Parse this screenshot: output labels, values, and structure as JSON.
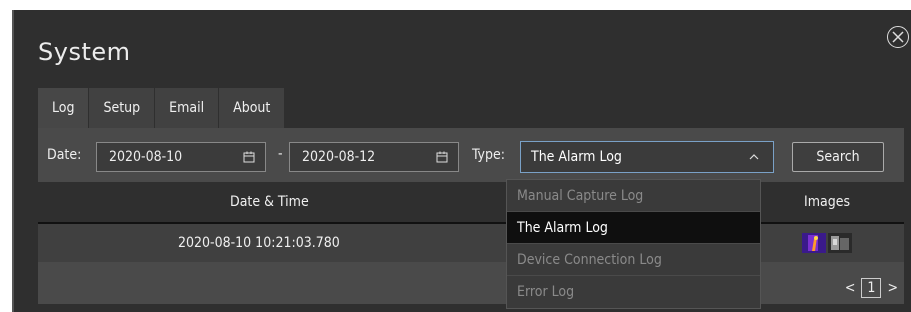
{
  "window": {
    "title": "System"
  },
  "tabs": [
    {
      "label": "Log"
    },
    {
      "label": "Setup"
    },
    {
      "label": "Email"
    },
    {
      "label": "About"
    }
  ],
  "filters": {
    "date_label": "Date:",
    "date_from": "2020-08-10",
    "date_separator": "-",
    "date_to": "2020-08-12",
    "type_label": "Type:",
    "type_selected": "The Alarm Log",
    "search_label": "Search"
  },
  "table": {
    "headers": [
      "Date & Time",
      "Images"
    ],
    "rows": [
      {
        "datetime": "2020-08-10 10:21:03.780"
      }
    ]
  },
  "dropdown": {
    "options": [
      "Manual Capture Log",
      "The Alarm Log",
      "Device Connection Log",
      "Error Log"
    ],
    "selected": "The Alarm Log"
  },
  "pagination": {
    "prev": "<",
    "current": "1",
    "next": ">"
  },
  "colors": {
    "background": "#2f2f2f",
    "panel": "#4a4a4a",
    "select_border": "#7aa1c7"
  },
  "icons": [
    "close-icon",
    "calendar-icon",
    "chevron-up-icon",
    "image-thumbnail-icon"
  ]
}
